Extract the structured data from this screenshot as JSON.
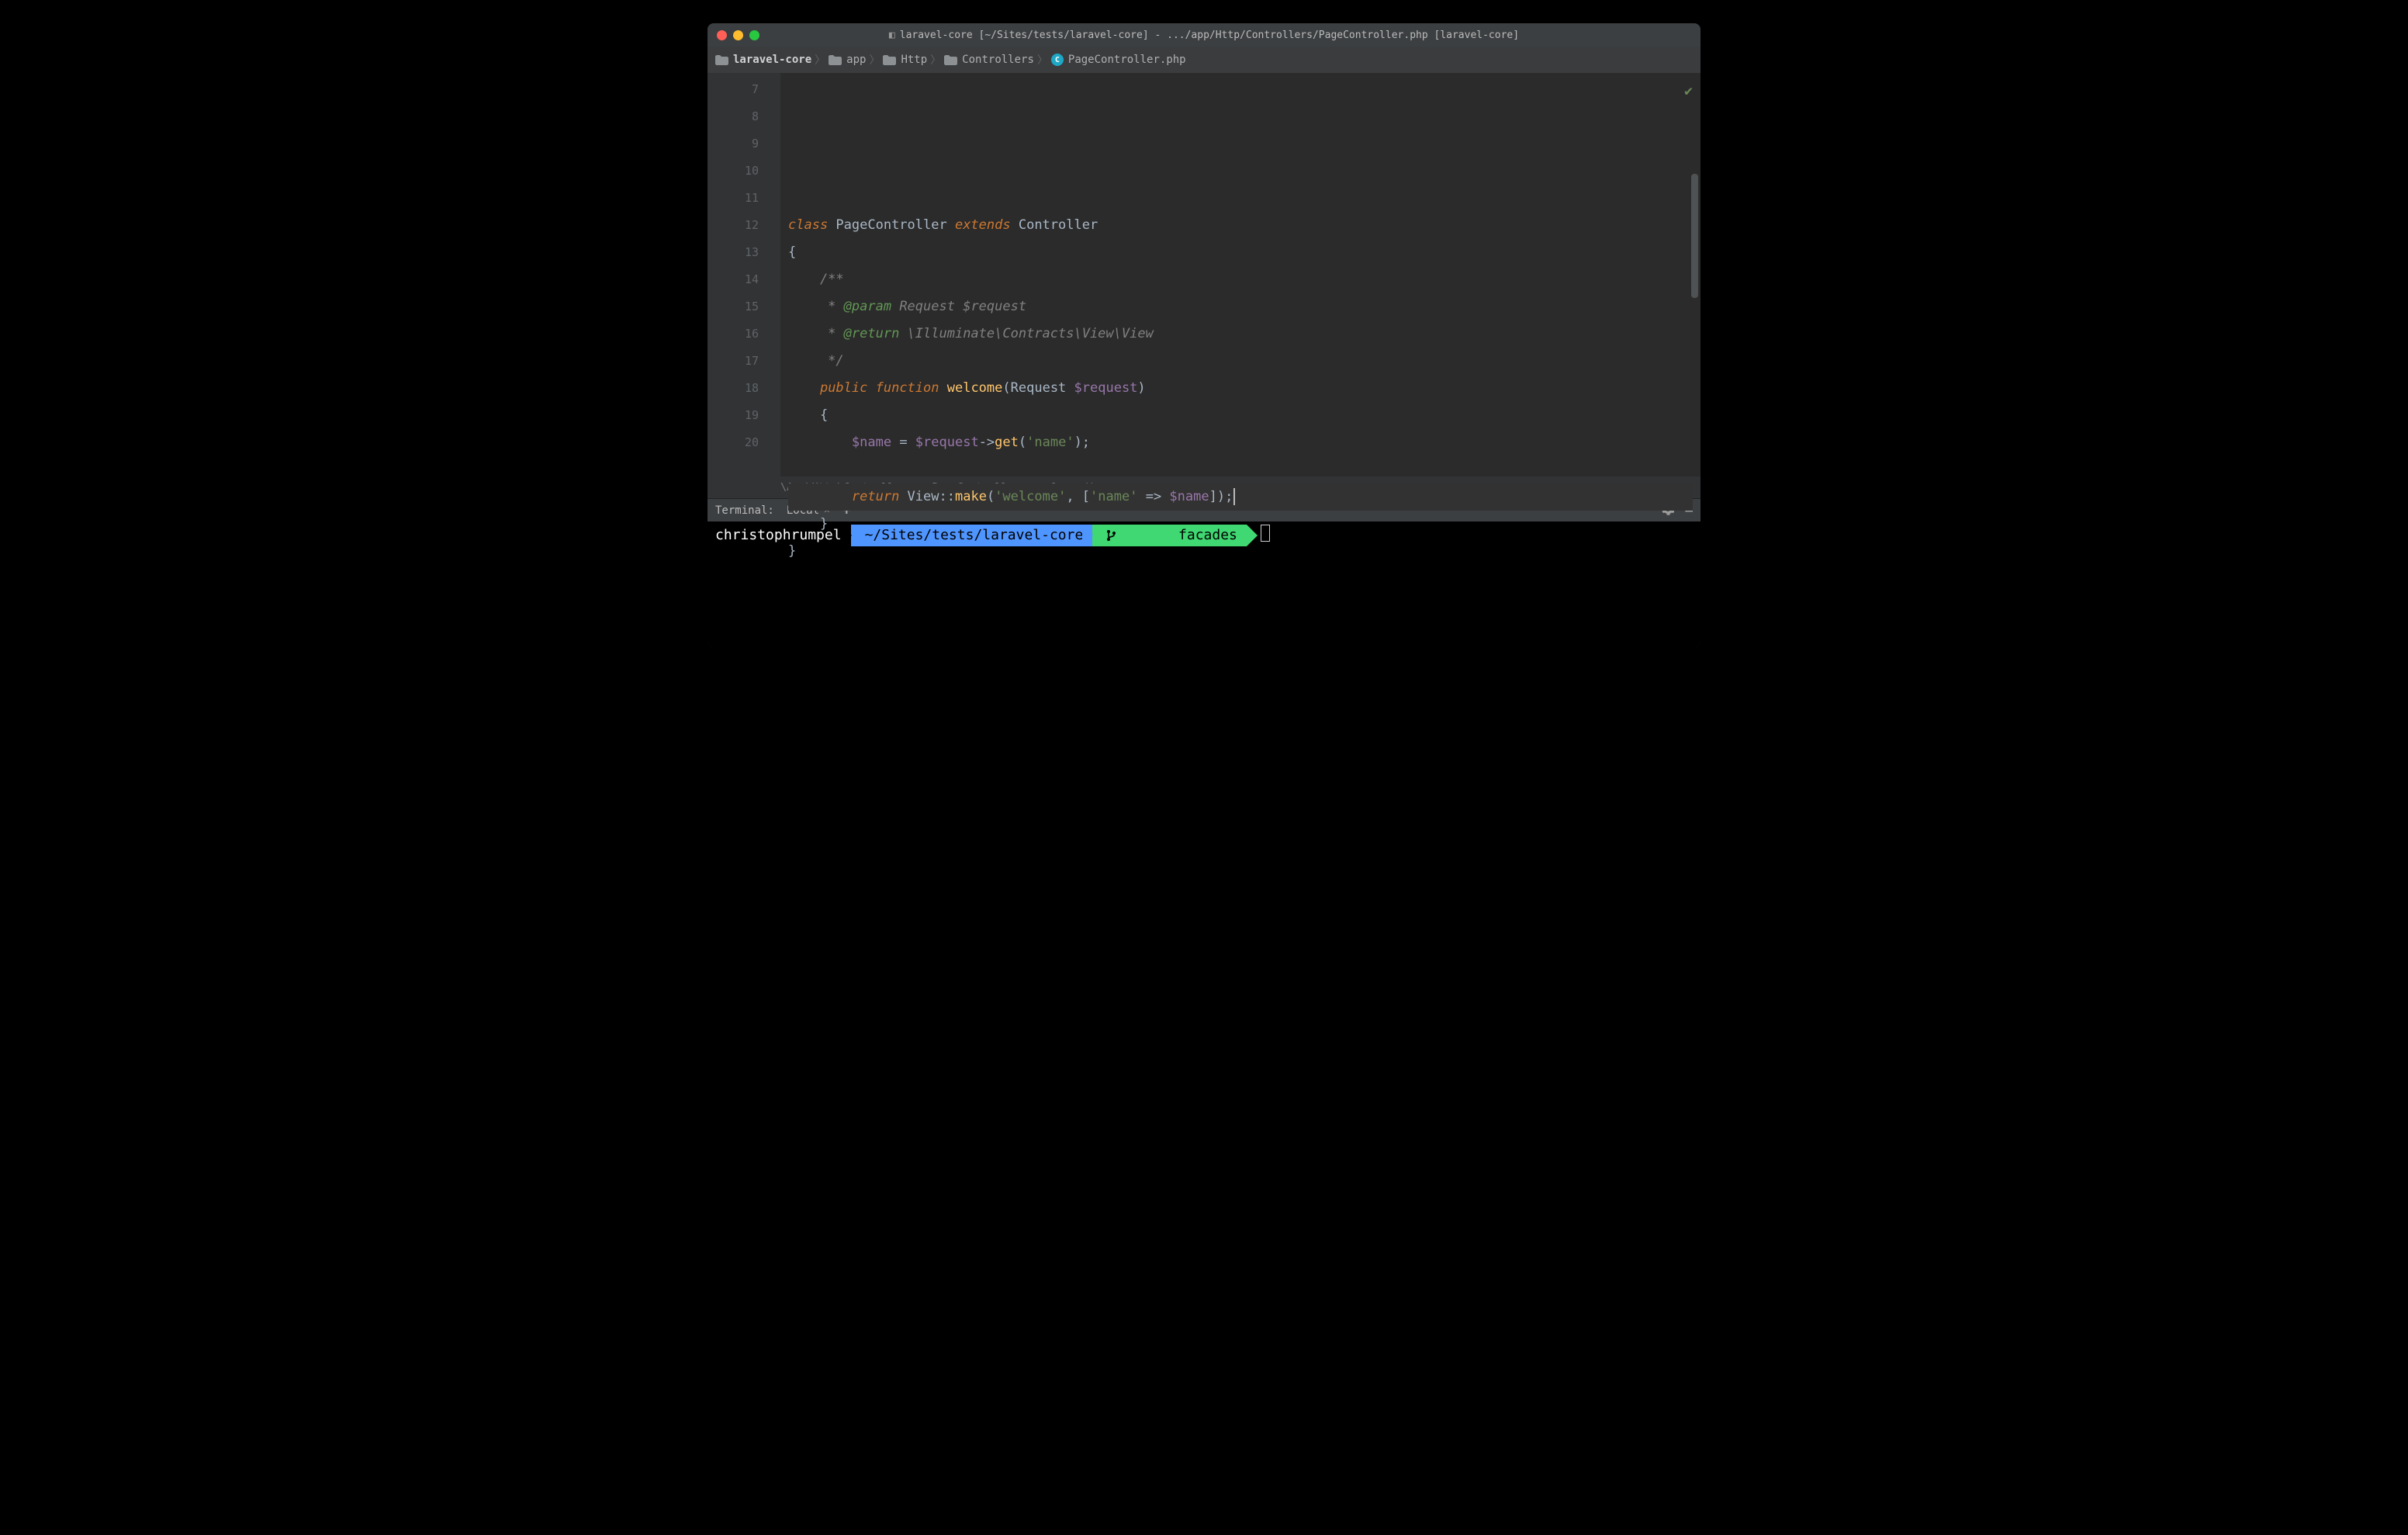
{
  "window": {
    "title": "laravel-core [~/Sites/tests/laravel-core] - .../app/Http/Controllers/PageController.php [laravel-core]"
  },
  "breadcrumbs": {
    "items": [
      {
        "label": "laravel-core",
        "icon": "folder",
        "bold": true
      },
      {
        "label": "app",
        "icon": "folder"
      },
      {
        "label": "Http",
        "icon": "folder"
      },
      {
        "label": "Controllers",
        "icon": "folder"
      },
      {
        "label": "PageController.php",
        "icon": "class"
      }
    ]
  },
  "editor": {
    "line_numbers": [
      "7",
      "8",
      "9",
      "10",
      "11",
      "12",
      "13",
      "14",
      "15",
      "16",
      "17",
      "18",
      "19",
      "20"
    ],
    "current_line": "18",
    "code": {
      "7": "",
      "8": {
        "tokens": [
          [
            "kw-it",
            "class "
          ],
          [
            "classname",
            "PageController "
          ],
          [
            "kw-it",
            "extends "
          ],
          [
            "classname",
            "Controller"
          ]
        ]
      },
      "9": {
        "text": "{"
      },
      "10": {
        "tokens": [
          [
            "comment",
            "    /**"
          ]
        ]
      },
      "11": {
        "tokens": [
          [
            "comment",
            "     * "
          ],
          [
            "doctag",
            "@param "
          ],
          [
            "docident",
            "Request "
          ],
          [
            "docident",
            "$request"
          ]
        ]
      },
      "12": {
        "tokens": [
          [
            "comment",
            "     * "
          ],
          [
            "doctag",
            "@return "
          ],
          [
            "docident",
            "\\Illuminate\\Contracts\\View\\View"
          ]
        ]
      },
      "13": {
        "tokens": [
          [
            "comment",
            "     */"
          ]
        ]
      },
      "14": {
        "tokens": [
          [
            "punct",
            "    "
          ],
          [
            "kw-it",
            "public "
          ],
          [
            "kw-it",
            "function "
          ],
          [
            "funcname",
            "welcome"
          ],
          [
            "punct",
            "("
          ],
          [
            "type",
            "Request "
          ],
          [
            "var",
            "$request"
          ],
          [
            "punct",
            ")"
          ]
        ]
      },
      "15": {
        "text": "    {"
      },
      "16": {
        "tokens": [
          [
            "punct",
            "        "
          ],
          [
            "var",
            "$name"
          ],
          [
            "punct",
            " = "
          ],
          [
            "var",
            "$request"
          ],
          [
            "punct",
            "->"
          ],
          [
            "method",
            "get"
          ],
          [
            "punct",
            "("
          ],
          [
            "str",
            "'name'"
          ],
          [
            "punct",
            ");"
          ]
        ]
      },
      "17": "",
      "18": {
        "tokens": [
          [
            "punct",
            "        "
          ],
          [
            "kw-it",
            "return "
          ],
          [
            "classname",
            "View"
          ],
          [
            "punct",
            "::"
          ],
          [
            "method",
            "make"
          ],
          [
            "punct",
            "("
          ],
          [
            "str",
            "'welcome'"
          ],
          [
            "punct",
            ", ["
          ],
          [
            "str",
            "'name'"
          ],
          [
            "punct",
            " => "
          ],
          [
            "var",
            "$name"
          ],
          [
            "punct",
            "]);"
          ]
        ]
      },
      "19": {
        "text": "    }"
      },
      "20": {
        "text": "}"
      }
    },
    "context_path": "\\App\\Http\\Controllers › PageController › welcome()"
  },
  "terminal": {
    "header_label": "Terminal:",
    "tab_label": "Local",
    "prompt": {
      "user": "christophrumpel",
      "path": "~/Sites/tests/laravel-core",
      "branch": "facades"
    }
  }
}
